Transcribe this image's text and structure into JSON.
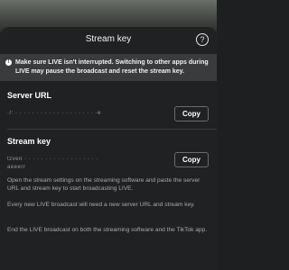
{
  "header": {
    "title": "Stream key",
    "help_icon": "question-circle-icon",
    "help_glyph": "?"
  },
  "banner": {
    "icon": "exclamation-icon",
    "icon_glyph": "!",
    "text": "Make sure LIVE isn't interrupted. Switching to other apps during LIVE may pause the broadcast and reset the stream key."
  },
  "server_url": {
    "label": "Server URL",
    "value_masked": "·/:  ·  ·   ·  ·  ·  ·  ·  ·  ·  ·  ·  ·  ·  ·  ·  ·  ·  ·  ·   ·e",
    "copy_label": "Copy"
  },
  "stream_key": {
    "label": "Stream key",
    "value_masked_line1": "tzven  ·  ·  ·  ·  ·  ·  ·  ·  ·  ·  ·  ·  ·  ·  ·  ·  ·  ·",
    "value_masked_line2": "aeeerr",
    "copy_label": "Copy"
  },
  "info": [
    "Open the stream settings on the streaming software and paste the server URL and stream key to start broadcasting LIVE.",
    "Every new LIVE broadcast will need a new server URL and stream key.",
    "End the LIVE broadcast on both the streaming software and the TikTok app."
  ]
}
